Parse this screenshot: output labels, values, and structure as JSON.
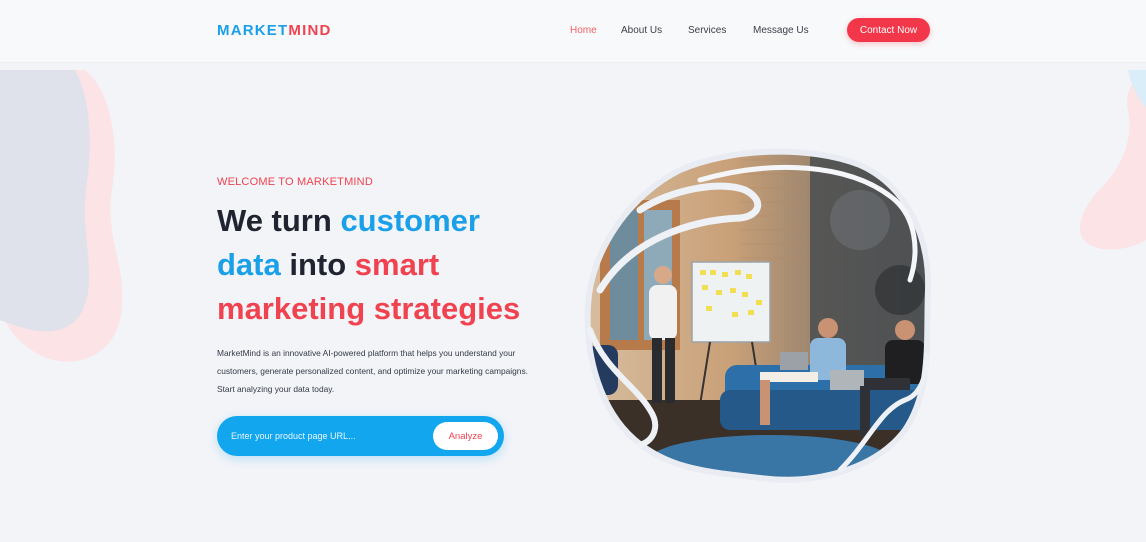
{
  "brand": {
    "part1": "MARKET",
    "part2": "MIND"
  },
  "nav": {
    "items": [
      {
        "label": "Home",
        "active": true
      },
      {
        "label": "About Us",
        "active": false
      },
      {
        "label": "Services",
        "active": false
      },
      {
        "label": "Message Us",
        "active": false
      }
    ],
    "cta_label": "Contact Now"
  },
  "hero": {
    "eyebrow": "WELCOME TO MARKETMIND",
    "headline": {
      "line1_a": "We turn ",
      "line1_b": "customer",
      "line2_a": "data",
      "line2_b": " into ",
      "line2_c": "smart",
      "line3": "marketing strategies"
    },
    "description": "MarketMind is an innovative AI-powered platform that helps you understand your customers, generate personalized content, and optimize your marketing campaigns. Start analyzing your data today.",
    "search": {
      "placeholder": "Enter your product page URL...",
      "value": "",
      "button_label": "Analyze"
    }
  },
  "colors": {
    "brand_blue": "#1aa0e8",
    "brand_red": "#f0424f",
    "cta_red": "#f2374a",
    "search_blue": "#11a6ee"
  }
}
